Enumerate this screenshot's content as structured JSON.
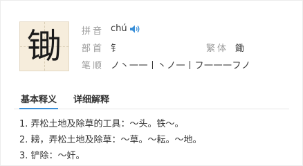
{
  "character": "锄",
  "info": {
    "pinyin_label": "拼音",
    "pinyin": "chú",
    "radical_label": "部首",
    "radical": "钅",
    "traditional_label": "繁体",
    "traditional": "鋤",
    "strokes_label": "笔顺",
    "strokes": "ノ丶一一丨丶ノ一丨フ一一一フノ"
  },
  "tabs": [
    {
      "label": "基本释义"
    },
    {
      "label": "详细解释"
    }
  ],
  "definitions": [
    "1. 弄松土地及除草的工具：～头。铁～。",
    "2. 耪，弄松土地及除草：～草。～耘。～地。",
    "3. 铲除：～奸。"
  ],
  "colors": {
    "accent": "#3a8fd8",
    "label": "#9a9a9a",
    "char_bg": "#f6eddc"
  },
  "icons": {
    "audio": "speaker-icon"
  }
}
